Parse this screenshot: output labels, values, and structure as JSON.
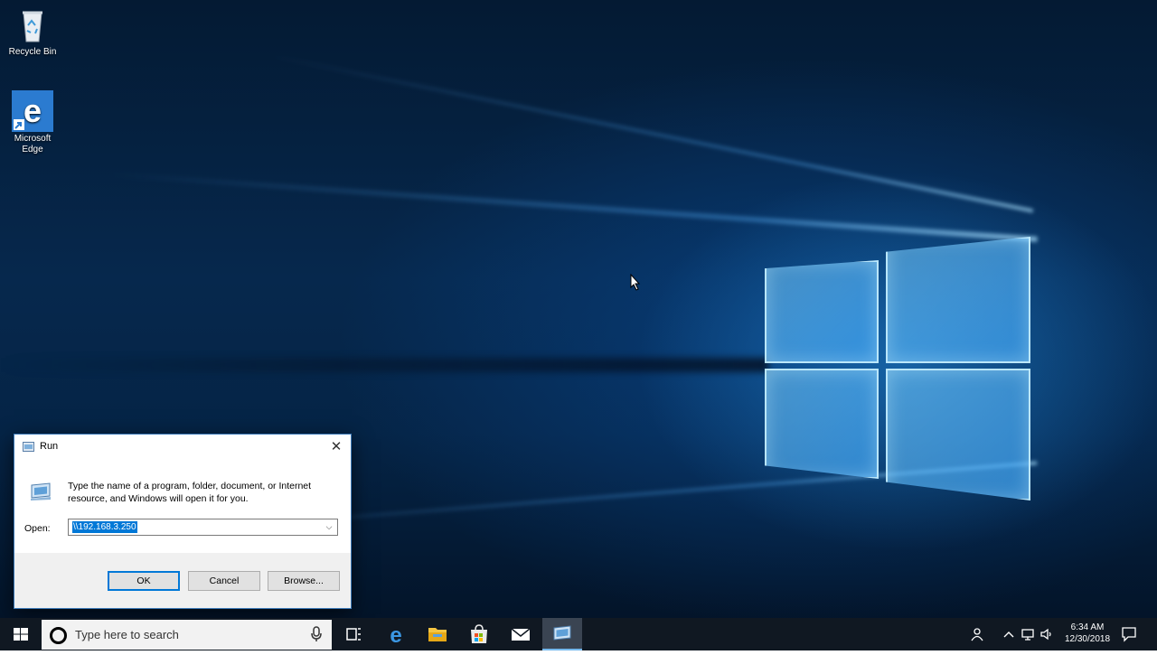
{
  "desktop": {
    "icons": [
      {
        "label": "Recycle Bin",
        "icon": "recycle-bin-icon"
      },
      {
        "label": "Microsoft Edge",
        "icon": "edge-icon"
      }
    ]
  },
  "run_dialog": {
    "title": "Run",
    "close_glyph": "✕",
    "description": "Type the name of a program, folder, document, or Internet resource, and Windows will open it for you.",
    "open_label": "Open:",
    "open_value": "\\\\192.168.3.250",
    "buttons": {
      "ok": "OK",
      "cancel": "Cancel",
      "browse": "Browse..."
    }
  },
  "taskbar": {
    "search_placeholder": "Type here to search",
    "apps": [
      "task-view-icon",
      "edge-icon",
      "file-explorer-icon",
      "store-icon",
      "mail-icon",
      "run-icon"
    ],
    "active_app": "run-icon",
    "clock": {
      "time": "6:34 AM",
      "date": "12/30/2018"
    }
  },
  "colors": {
    "accent": "#0078d7",
    "taskbar": "#101822",
    "desktop_dark": "#041a33",
    "logo_glow": "#78cdff"
  }
}
